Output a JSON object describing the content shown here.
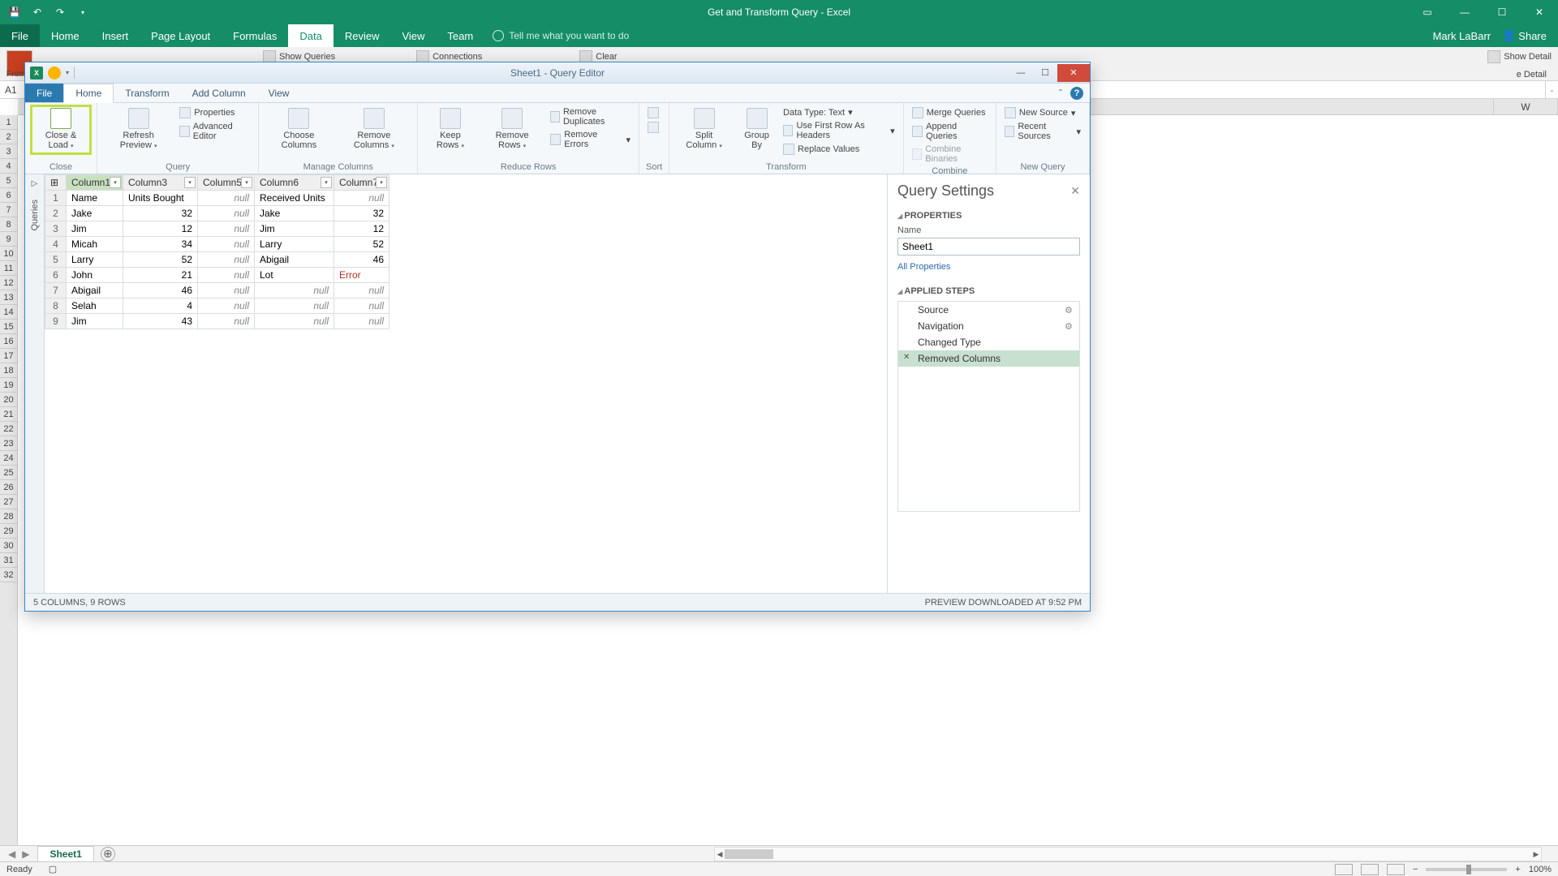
{
  "excel": {
    "title": "Get and Transform Query - Excel",
    "tabs": [
      "File",
      "Home",
      "Insert",
      "Page Layout",
      "Formulas",
      "Data",
      "Review",
      "View",
      "Team"
    ],
    "active_tab": "Data",
    "tell_me": "Tell me what you want to do",
    "user": "Mark LaBarr",
    "share": "Share",
    "cell_ref": "A1",
    "ribbon_snippets": {
      "from_access": "From Access",
      "show_queries": "Show Queries",
      "connections": "Connections",
      "clear": "Clear",
      "show_detail": "Show Detail",
      "hide_detail": "e Detail"
    },
    "col_header_right": "W",
    "row_count": 32,
    "sheet": "Sheet1",
    "status_ready": "Ready",
    "zoom": "100%"
  },
  "qe": {
    "title": "Sheet1 - Query Editor",
    "tabs": [
      "File",
      "Home",
      "Transform",
      "Add Column",
      "View"
    ],
    "active_tab": "Home",
    "ribbon": {
      "close_load": "Close & Load",
      "close_group": "Close",
      "refresh": "Refresh Preview",
      "properties": "Properties",
      "adv_editor": "Advanced Editor",
      "query_group": "Query",
      "choose_cols": "Choose Columns",
      "remove_cols": "Remove Columns",
      "manage_cols_group": "Manage Columns",
      "keep_rows": "Keep Rows",
      "remove_rows": "Remove Rows",
      "remove_dup": "Remove Duplicates",
      "remove_err": "Remove Errors",
      "reduce_group": "Reduce Rows",
      "sort_group": "Sort",
      "split_col": "Split Column",
      "group_by": "Group By",
      "data_type": "Data Type: Text",
      "first_row": "Use First Row As Headers",
      "replace": "Replace Values",
      "transform_group": "Transform",
      "merge": "Merge Queries",
      "append": "Append Queries",
      "combine_bin": "Combine Binaries",
      "combine_group": "Combine",
      "new_source": "New Source",
      "recent_sources": "Recent Sources",
      "new_query_group": "New Query"
    },
    "side_label": "Queries",
    "columns": [
      "Column1",
      "Column3",
      "Column5",
      "Column6",
      "Column7"
    ],
    "selected_col": "Column1",
    "rows": [
      {
        "c1": "Name",
        "c3": "Units Bought",
        "c5": null,
        "c6": "Received Units",
        "c7": null
      },
      {
        "c1": "Jake",
        "c3": 32,
        "c5": null,
        "c6": "Jake",
        "c7": 32
      },
      {
        "c1": "Jim",
        "c3": 12,
        "c5": null,
        "c6": "Jim",
        "c7": 12
      },
      {
        "c1": "Micah",
        "c3": 34,
        "c5": null,
        "c6": "Larry",
        "c7": 52
      },
      {
        "c1": "Larry",
        "c3": 52,
        "c5": null,
        "c6": "Abigail",
        "c7": 46
      },
      {
        "c1": "John",
        "c3": 21,
        "c5": null,
        "c6": "Lot",
        "c7": "Error"
      },
      {
        "c1": "Abigail",
        "c3": 46,
        "c5": null,
        "c6": null,
        "c7": null
      },
      {
        "c1": "Selah",
        "c3": 4,
        "c5": null,
        "c6": null,
        "c7": null
      },
      {
        "c1": "Jim",
        "c3": 43,
        "c5": null,
        "c6": null,
        "c7": null
      }
    ],
    "settings": {
      "heading": "Query Settings",
      "properties_hd": "PROPERTIES",
      "name_label": "Name",
      "name_value": "Sheet1",
      "all_props": "All Properties",
      "steps_hd": "APPLIED STEPS",
      "steps": [
        "Source",
        "Navigation",
        "Changed Type",
        "Removed Columns"
      ],
      "selected_step": "Removed Columns",
      "geared_steps": [
        "Source",
        "Navigation"
      ]
    },
    "status_left": "5 COLUMNS, 9 ROWS",
    "status_right": "PREVIEW DOWNLOADED AT 9:52 PM"
  }
}
